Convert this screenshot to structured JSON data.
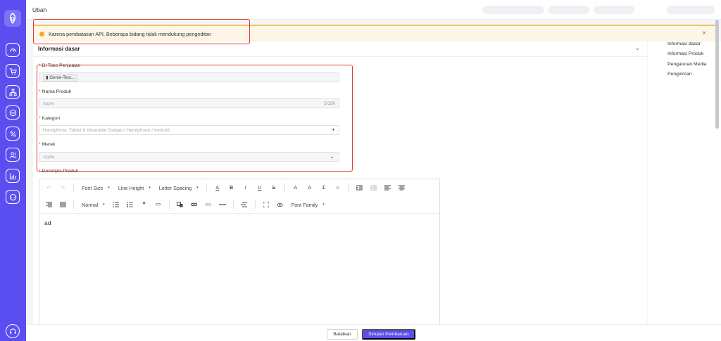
{
  "header": {
    "title": "Ubah"
  },
  "alert": {
    "text": "Karena pembatasan API,  Beberapa bidang tidak mendukung pengeditan",
    "close": "×"
  },
  "section": {
    "title": "Informasi dasar",
    "chevron": "⌄"
  },
  "form": {
    "store": {
      "label": "Di Toko Penjualan",
      "tag": "Genie-Test..."
    },
    "name": {
      "label": "Nama Produk",
      "value": "apple",
      "count": "5/150"
    },
    "category": {
      "label": "Kategori",
      "value": "Handphone, Tablet & Wearable Gadget / Handphone / Android"
    },
    "brand": {
      "label": "Merek",
      "value": "Apple"
    },
    "description": {
      "label": "Deskripsi Produk"
    }
  },
  "toolbar": {
    "undo": "↶",
    "redo": "↷",
    "font_size": "Font Size",
    "line_height": "Line Height",
    "letter_spacing": "Letter Spacing",
    "font_color": "A",
    "bold": "B",
    "italic": "I",
    "underline": "U",
    "strikethrough": "S",
    "superscript": "A",
    "subscript": "A",
    "clear_format": "T",
    "emoji": "☺",
    "block_format": "Normal",
    "quote": "❞",
    "code": "<>",
    "font_family": "Font Family",
    "dropdown_caret": "▾"
  },
  "editor": {
    "content": "ad"
  },
  "right_nav": {
    "items": [
      "Informasi dasar",
      "Informasi Produk",
      "Pengaturan Media",
      "Pengiriman"
    ]
  },
  "footer": {
    "cancel": "Batalkan",
    "save": "Simpan Pembaruan"
  },
  "sidebar": {
    "icons": [
      "dashboard-icon",
      "cart-icon",
      "hierarchy-icon",
      "box-icon",
      "discount-icon",
      "users-icon",
      "chart-icon",
      "chat-icon",
      "headset-icon"
    ]
  },
  "colors": {
    "brand": "#5b4ef0",
    "warning": "#f3a632",
    "highlight": "#e03b32"
  }
}
